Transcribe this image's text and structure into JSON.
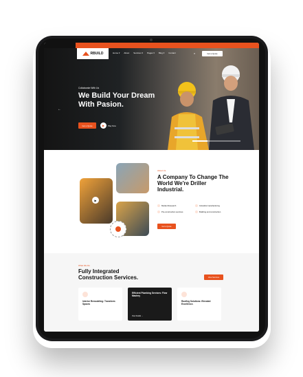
{
  "topbar": {
    "left_text": "",
    "right_text": ""
  },
  "nav": {
    "logo_text": "RBUILD",
    "menu": [
      "Home ▾",
      "About",
      "Services ▾",
      "Pages ▾",
      "Blog ▾",
      "Contact"
    ],
    "quote_button": "Get a Quote"
  },
  "hero": {
    "eyebrow": "Collaborate With Us",
    "title": "We Build Your Dream With Pasion.",
    "description": "",
    "primary_button": "Get a Quote",
    "video_label": "Play Now"
  },
  "about": {
    "eyebrow": "About Us",
    "title": "A Company To Change The World We're Driller Industrial.",
    "description": "",
    "features": [
      "Market Research",
      "Industrial manufacturing",
      "Pre-construction services",
      "Building and construction"
    ],
    "button": "Get a Quote"
  },
  "services": {
    "eyebrow": "What We Do",
    "title": "Fully Integrated Construction Services.",
    "button": "View Services",
    "cards": [
      {
        "title": "Interior Remodeling: Transform Spaces",
        "description": "",
        "link": ""
      },
      {
        "title": "Efficient Plumbing Services: Flow Mastery",
        "description": "",
        "link": "View Details →"
      },
      {
        "title": "Roofing Solutions: Elevated Excellence.",
        "description": "",
        "link": ""
      }
    ]
  },
  "colors": {
    "accent": "#e8521e",
    "dark": "#111111"
  }
}
